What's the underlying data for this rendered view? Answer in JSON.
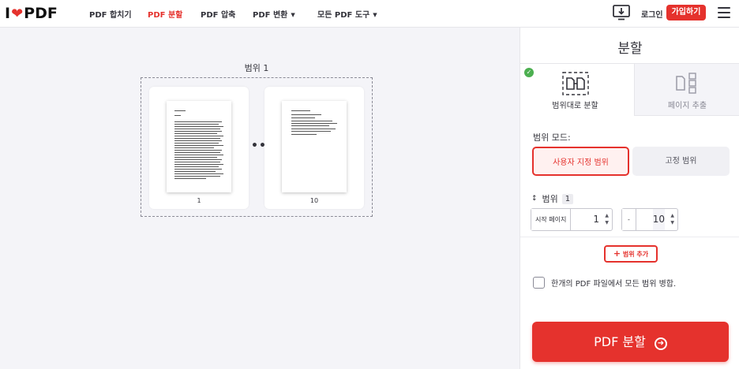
{
  "header": {
    "logo_left": "I",
    "logo_right": "PDF",
    "nav": [
      {
        "label": "PDF 합치기",
        "active": false,
        "caret": false
      },
      {
        "label": "PDF 분할",
        "active": true,
        "caret": false
      },
      {
        "label": "PDF 압축",
        "active": false,
        "caret": false
      },
      {
        "label": "PDF 변환",
        "active": false,
        "caret": true
      },
      {
        "label": "모든 PDF 도구",
        "active": false,
        "caret": true
      }
    ],
    "login": "로그인",
    "signup": "가입하기"
  },
  "main": {
    "range_label": "범위 1",
    "pages": [
      {
        "number": "1"
      },
      {
        "number": "10"
      }
    ]
  },
  "sidebar": {
    "title": "분할",
    "tabs": [
      {
        "label": "범위대로 분할",
        "selected": true
      },
      {
        "label": "페이지 추출",
        "selected": false
      }
    ],
    "mode_label": "범위 모드:",
    "modes": [
      {
        "label": "사용자 지정 범위",
        "selected": true
      },
      {
        "label": "고정 범위",
        "selected": false
      }
    ],
    "range": {
      "label": "범위",
      "index": "1",
      "start_label": "시작 페이지",
      "start_value": "1",
      "end_label": "-",
      "end_value": "10"
    },
    "add_range": "범위 추가",
    "merge_label": "한개의 PDF 파일에서 모든 범위 병합.",
    "split_button": "PDF 분할"
  },
  "colors": {
    "accent": "#e5322d",
    "success": "#4caf50"
  }
}
